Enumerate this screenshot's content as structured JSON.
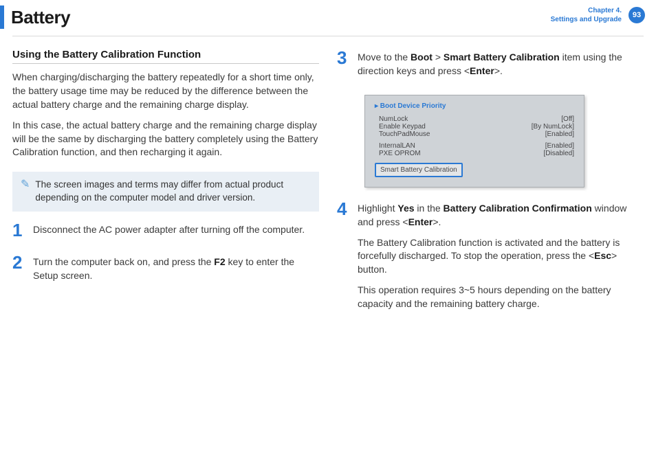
{
  "header": {
    "title": "Battery",
    "chapter_line1": "Chapter 4.",
    "chapter_line2": "Settings and Upgrade",
    "page_number": "93"
  },
  "left": {
    "subhead": "Using the Battery Calibration Function",
    "p1": "When charging/discharging the battery repeatedly for a short time only, the battery usage time may be reduced by the difference between the actual battery charge and the remaining charge display.",
    "p2": "In this case, the actual battery charge and the remaining charge display will be the same by discharging the battery completely using the Battery Calibration function, and then recharging it again.",
    "note": "The screen images and terms may differ from actual product depending on the computer model and driver version.",
    "step1_num": "1",
    "step1_text": "Disconnect the AC power adapter after turning off the computer.",
    "step2_num": "2",
    "step2_a": "Turn the computer back on, and press the ",
    "step2_key": "F2",
    "step2_b": " key to enter the Setup screen."
  },
  "right": {
    "step3_num": "3",
    "step3_a": "Move to the ",
    "step3_boot": "Boot",
    "step3_sep": " > ",
    "step3_sbc": "Smart Battery Calibration",
    "step3_b": " item using the direction keys and press <",
    "step3_enter": "Enter",
    "step3_c": ">.",
    "bios": {
      "head": "▸ Boot Device Priority",
      "r1l": "NumLock",
      "r1r": "[Off]",
      "r2l": "Enable Keypad",
      "r2r": "[By NumLock]",
      "r3l": "TouchPadMouse",
      "r3r": "[Enabled]",
      "r4l": "InternalLAN",
      "r4r": "[Enabled]",
      "r5l": "PXE OPROM",
      "r5r": "[Disabled]",
      "highlight": "Smart Battery Calibration"
    },
    "step4_num": "4",
    "step4_a": "Highlight ",
    "step4_yes": "Yes",
    "step4_b": " in the ",
    "step4_win": "Battery Calibration Confirmation",
    "step4_c": " window and press <",
    "step4_enter": "Enter",
    "step4_d": ">.",
    "step4_p2a": "The Battery Calibration function is activated and the battery is forcefully discharged. To stop the operation, press the <",
    "step4_esc": "Esc",
    "step4_p2b": "> button.",
    "step4_p3": "This operation requires 3~5 hours depending on the battery capacity and the remaining battery charge."
  }
}
